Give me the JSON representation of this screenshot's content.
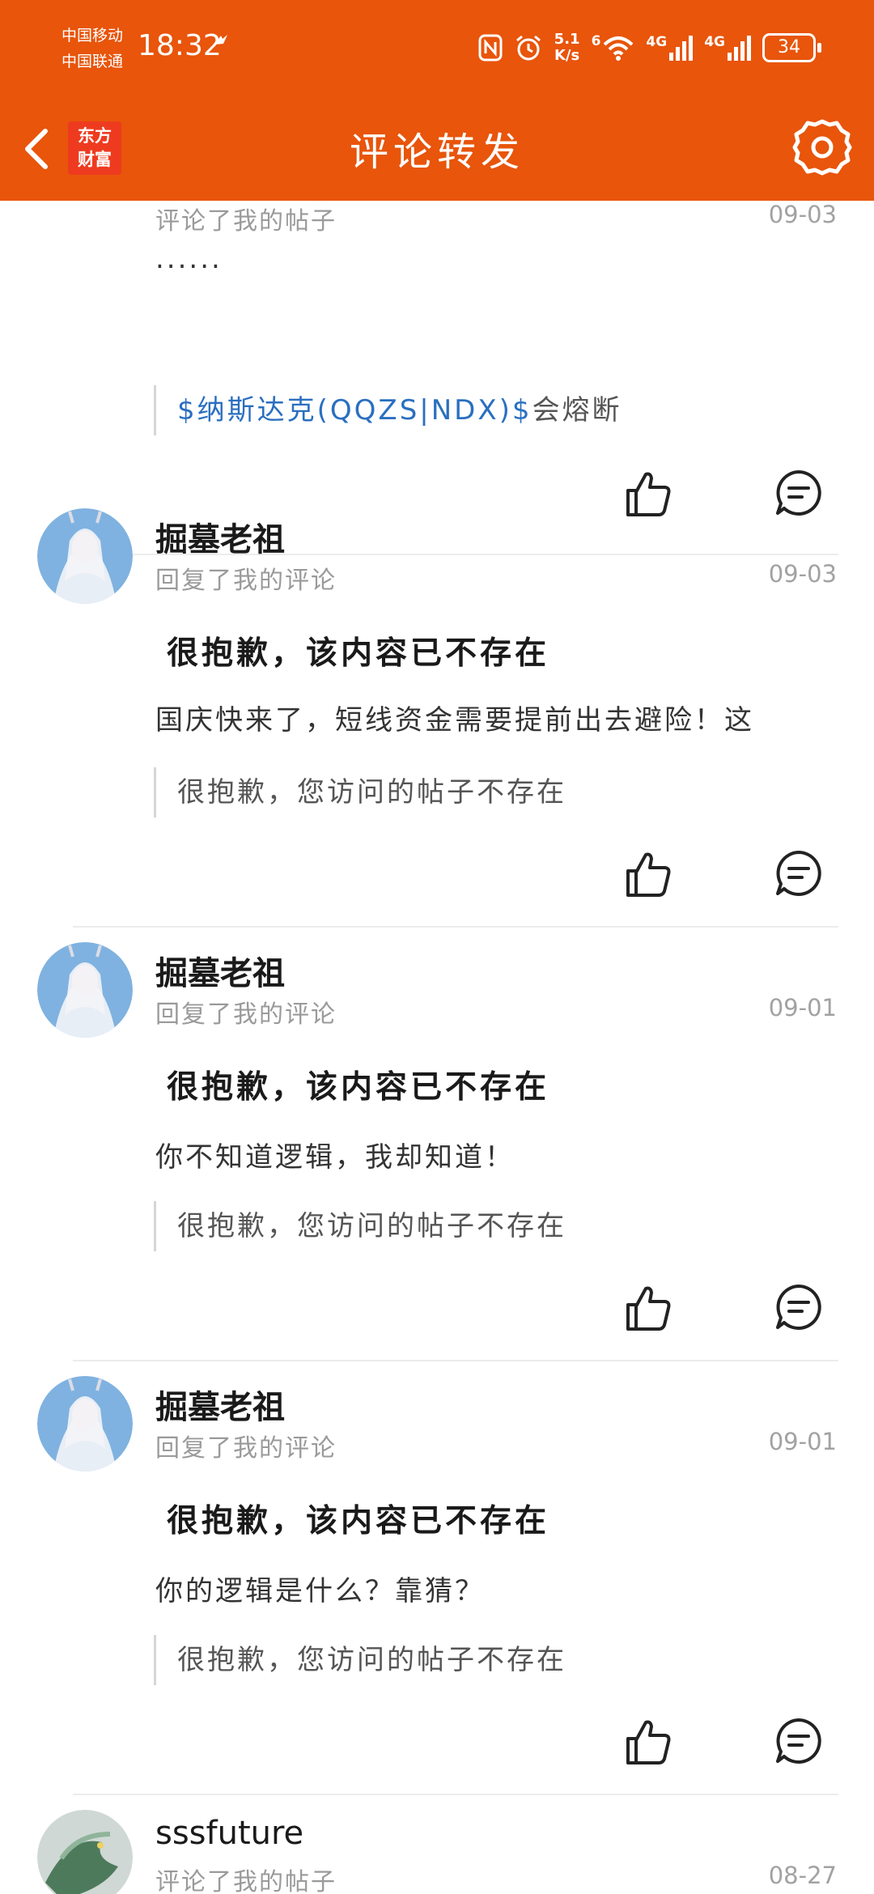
{
  "status_bar": {
    "carrier_1": "中国移动",
    "carrier_2": "中国联通",
    "time": "18:32",
    "net_speed_value": "5.1",
    "net_speed_unit": "K/s",
    "wifi_badge": "6",
    "net_1": "4G",
    "net_2": "4G",
    "battery": "34"
  },
  "header": {
    "logo_line_1": "东方",
    "logo_line_2": "财富",
    "title": "评论转发"
  },
  "items": [
    {
      "action": "评论了我的帖子",
      "date": "09-03",
      "comment": "......",
      "quote_link": "$纳斯达克(QQZS|NDX)$",
      "quote_rest": "会熔断"
    },
    {
      "username": "掘墓老祖",
      "action": "回复了我的评论",
      "date": "09-03",
      "deleted_notice": "很抱歉，该内容已不存在",
      "comment": "国庆快来了，短线资金需要提前出去避险！这",
      "quote": "很抱歉，您访问的帖子不存在"
    },
    {
      "username": "掘墓老祖",
      "action": "回复了我的评论",
      "date": "09-01",
      "deleted_notice": "很抱歉，该内容已不存在",
      "comment": "你不知道逻辑，我却知道！",
      "quote": "很抱歉，您访问的帖子不存在"
    },
    {
      "username": "掘墓老祖",
      "action": "回复了我的评论",
      "date": "09-01",
      "deleted_notice": "很抱歉，该内容已不存在",
      "comment": "你的逻辑是什么？靠猜？",
      "quote": "很抱歉，您访问的帖子不存在"
    },
    {
      "username": "sssfuture",
      "action": "评论了我的帖子",
      "date": "08-27"
    }
  ],
  "colors": {
    "header_bg": "#e8550b",
    "link": "#2a6fc0",
    "muted_text": "#9a9a9a"
  }
}
